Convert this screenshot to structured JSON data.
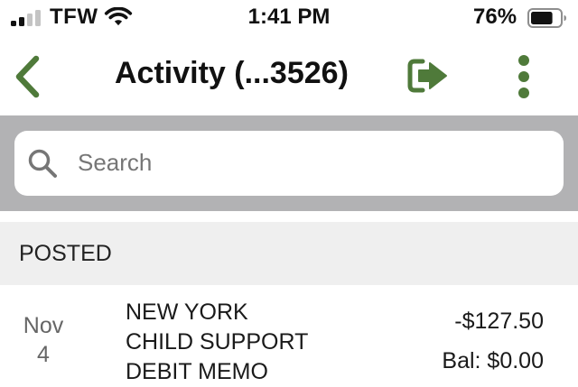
{
  "status_bar": {
    "carrier": "TFW",
    "time": "1:41 PM",
    "battery_percent": "76%",
    "battery_level": 0.76,
    "signal_bars": 2,
    "signal_bars_total": 4
  },
  "header": {
    "title": "Activity (...3526)",
    "back_icon": "chevron-left-icon",
    "logout_icon": "sign-out-icon",
    "more_icon": "vertical-ellipsis-icon"
  },
  "search": {
    "placeholder": "Search",
    "icon": "search-icon"
  },
  "sections": [
    {
      "label": "POSTED",
      "transactions": [
        {
          "month": "Nov",
          "day": "4",
          "description_lines": [
            "NEW YORK",
            "CHILD SUPPORT",
            "DEBIT MEMO"
          ],
          "amount": "-$127.50",
          "balance": "Bal: $0.00"
        }
      ]
    }
  ],
  "colors": {
    "accent_green": "#4f7a3a",
    "search_band": "#b2b2b4",
    "section_header_bg": "#efefef"
  }
}
